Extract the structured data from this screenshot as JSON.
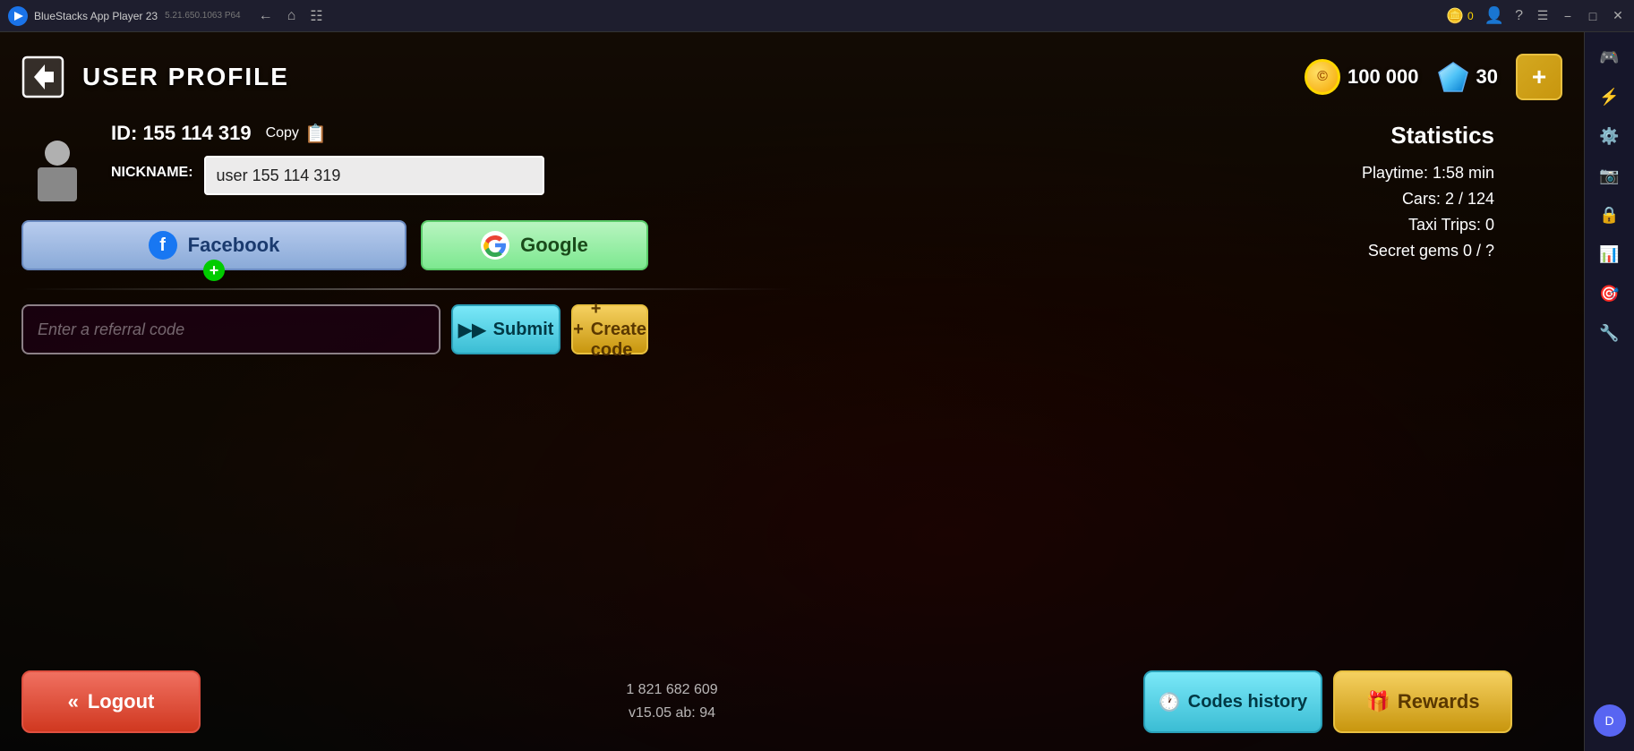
{
  "window": {
    "title": "BlueStacks App Player 23",
    "subtitle": "5.21.650.1063  P64",
    "coin_label": "0"
  },
  "titlebar": {
    "nav": [
      "back",
      "home",
      "layers"
    ],
    "controls": [
      "hamburger",
      "minimize",
      "maximize",
      "close"
    ]
  },
  "header": {
    "back_label": "◀",
    "title": "USER PROFILE",
    "coins": "100 000",
    "gems": "30",
    "add_label": "+"
  },
  "profile": {
    "id_label": "ID: 155 114 319",
    "copy_label": "Copy",
    "nickname_label": "NICKNAME:",
    "nickname_value": "user 155 114 319",
    "nickname_placeholder": "user 155 114 319"
  },
  "social_buttons": {
    "facebook_label": "Facebook",
    "google_label": "Google"
  },
  "referral": {
    "placeholder": "Enter a referral code",
    "submit_label": "Submit",
    "create_label": "+ Create code"
  },
  "statistics": {
    "title": "Statistics",
    "rows": [
      {
        "label": "Playtime: 1:58 min"
      },
      {
        "label": "Cars: 2 / 124"
      },
      {
        "label": "Taxi Trips: 0"
      },
      {
        "label": "Secret gems 0 / ?"
      }
    ]
  },
  "bottom": {
    "logout_label": "Logout",
    "version_line1": "1 821 682 609",
    "version_line2": "v15.05 ab: 94",
    "codes_history_label": "Codes history",
    "rewards_label": "Rewards"
  },
  "sidebar": {
    "icons": [
      "🎮",
      "⚡",
      "⚙️",
      "📷",
      "🔒",
      "📊",
      "🎯",
      "🔧"
    ]
  }
}
